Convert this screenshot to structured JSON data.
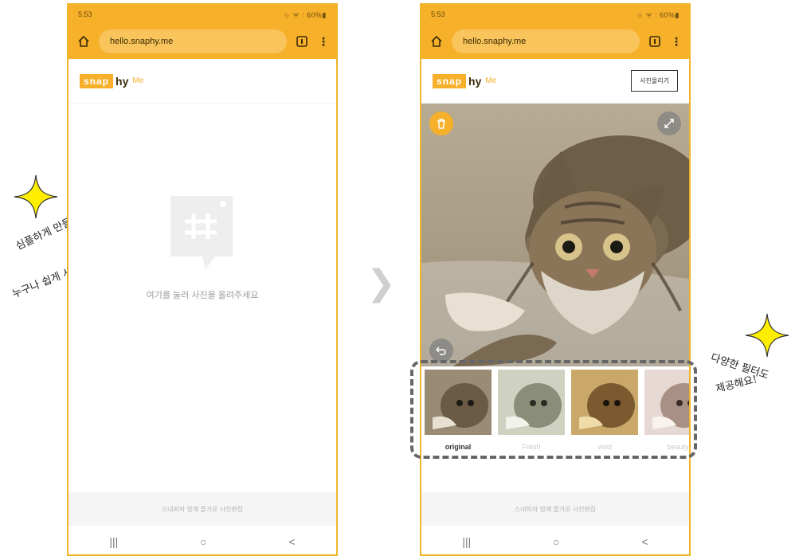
{
  "left_phone": {
    "status": {
      "time": "5:53",
      "icons": "☼ ᯤ ⫶ 60%▮"
    },
    "browser": {
      "url": "hello.snaphy.me"
    },
    "logo": {
      "snap": "snap",
      "hy": "hy",
      "me": "Me"
    },
    "empty_state": {
      "text": "여기를 눌러 사진을 올려주세요"
    },
    "footer_text": "스내피와 함께 즐거운 사진편집",
    "nav": {
      "recent": "|||",
      "home": "○",
      "back": "<"
    }
  },
  "right_phone": {
    "status": {
      "time": "5:53",
      "icons": "☼ ᯤ ⫶ 60%▮"
    },
    "browser": {
      "url": "hello.snaphy.me"
    },
    "logo": {
      "snap": "snap",
      "hy": "hy",
      "me": "Me"
    },
    "save_button": "사진올리기",
    "filters": [
      {
        "label": "original",
        "active": true
      },
      {
        "label": "Fresh",
        "active": false
      },
      {
        "label": "vivid",
        "active": false
      },
      {
        "label": "beauty",
        "active": false
      }
    ],
    "footer_text": "스내피와 함께 즐거운 사진편집",
    "nav": {
      "recent": "|||",
      "home": "○",
      "back": "<"
    }
  },
  "separator": "❯",
  "annotations": {
    "left_line1": "심플하게 만들어서",
    "left_line2": "누구나 쉽게 사용 가능!",
    "right_line1": "다양한 필터도",
    "right_line2": "제공해요!"
  },
  "colors": {
    "accent": "#f6b02a",
    "sparkle": "#ffee00"
  }
}
